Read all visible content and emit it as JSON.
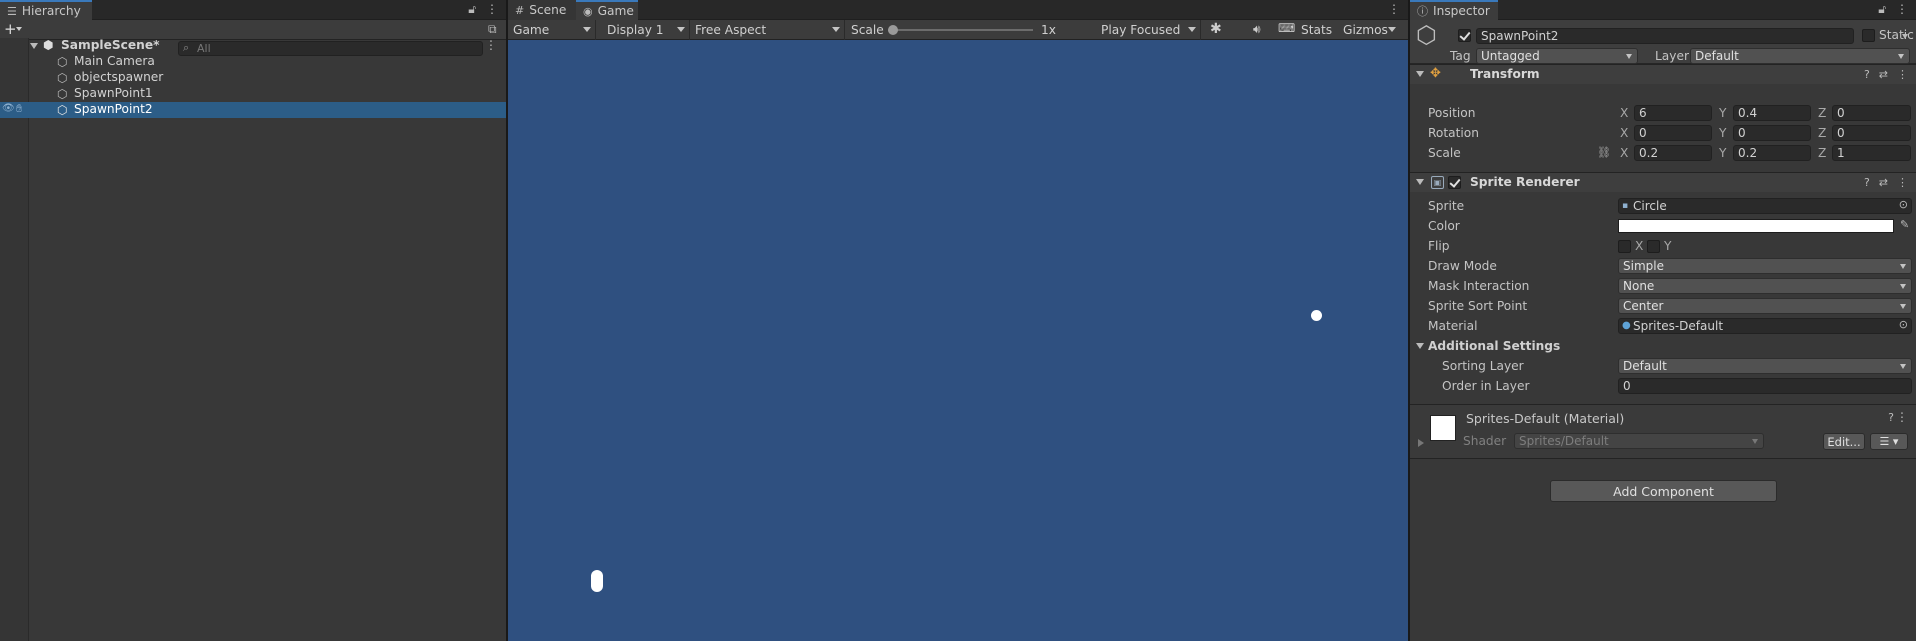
{
  "hierarchy": {
    "tab_label": "Hierarchy",
    "search_placeholder": "All",
    "items": [
      {
        "label": "SampleScene*"
      },
      {
        "label": "Main Camera"
      },
      {
        "label": "objectspawner"
      },
      {
        "label": "SpawnPoint1"
      },
      {
        "label": "SpawnPoint2"
      }
    ]
  },
  "game": {
    "tabs": [
      {
        "label": "Scene"
      },
      {
        "label": "Game"
      }
    ],
    "toolbar": {
      "view": "Game",
      "display": "Display 1",
      "aspect": "Free Aspect",
      "scale_label": "Scale",
      "scale_value": "1x",
      "play_mode": "Play Focused",
      "stats": "Stats",
      "gizmos": "Gizmos"
    },
    "background_color": "#2f5080"
  },
  "inspector": {
    "tab_label": "Inspector",
    "object_name": "SpawnPoint2",
    "static_label": "Static",
    "tag_label": "Tag",
    "tag_value": "Untagged",
    "layer_label": "Layer",
    "layer_value": "Default",
    "transform": {
      "title": "Transform",
      "position_label": "Position",
      "rotation_label": "Rotation",
      "scale_label": "Scale",
      "position": {
        "x": "6",
        "y": "0.4",
        "z": "0"
      },
      "rotation": {
        "x": "0",
        "y": "0",
        "z": "0"
      },
      "scale": {
        "x": "0.2",
        "y": "0.2",
        "z": "1"
      }
    },
    "axes": {
      "x": "X",
      "y": "Y",
      "z": "Z"
    },
    "sprite_renderer": {
      "title": "Sprite Renderer",
      "sprite_label": "Sprite",
      "sprite_value": "Circle",
      "color_label": "Color",
      "color_value": "#ffffff",
      "flip_label": "Flip",
      "draw_mode_label": "Draw Mode",
      "draw_mode_value": "Simple",
      "mask_label": "Mask Interaction",
      "mask_value": "None",
      "sort_point_label": "Sprite Sort Point",
      "sort_point_value": "Center",
      "material_label": "Material",
      "material_value": "Sprites-Default",
      "additional_label": "Additional Settings",
      "sorting_layer_label": "Sorting Layer",
      "sorting_layer_value": "Default",
      "order_label": "Order in Layer",
      "order_value": "0"
    },
    "material": {
      "name": "Sprites-Default (Material)",
      "shader_label": "Shader",
      "shader_value": "Sprites/Default",
      "edit_label": "Edit..."
    },
    "add_component_label": "Add Component"
  }
}
